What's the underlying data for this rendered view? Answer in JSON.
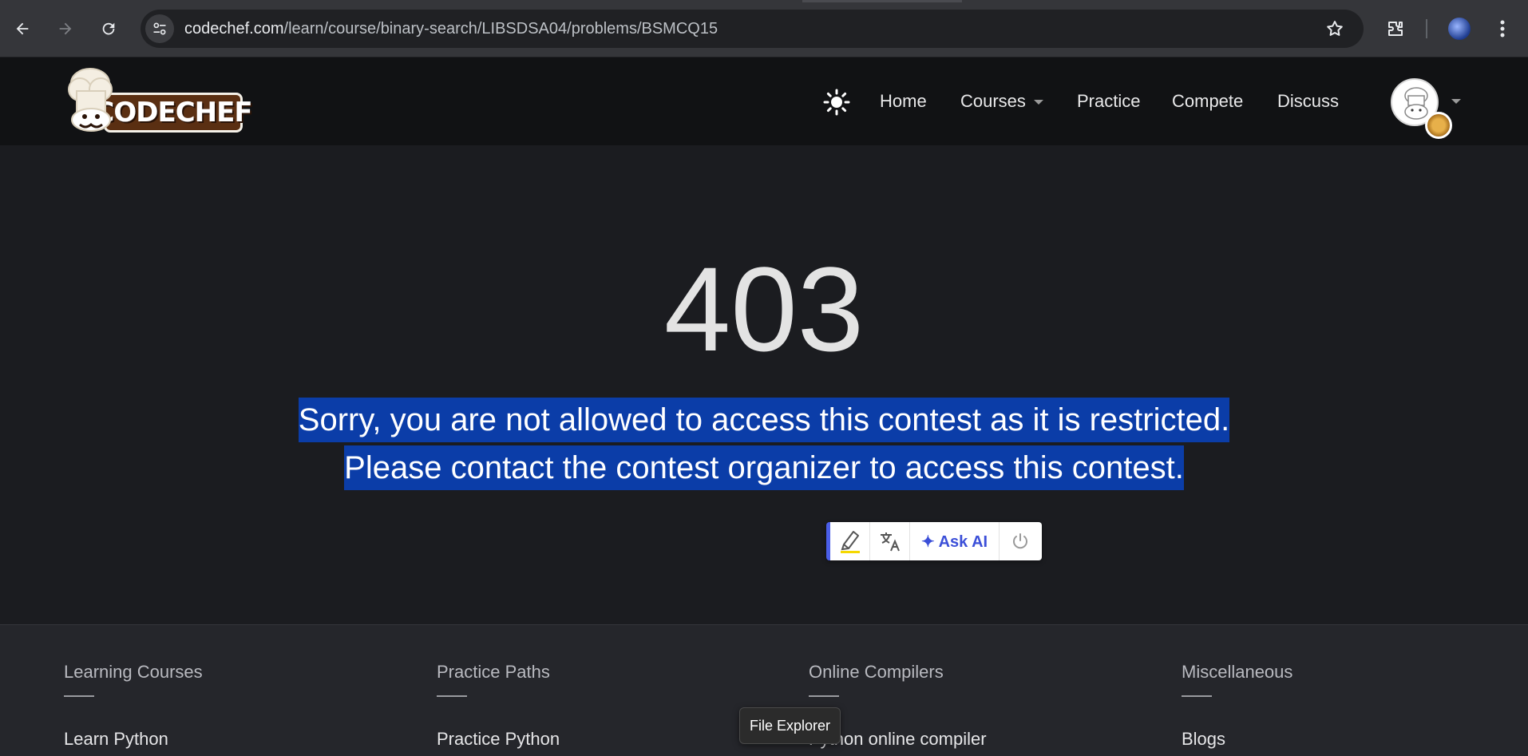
{
  "browser": {
    "url_host": "codechef.com",
    "url_path": "/learn/course/binary-search/LIBSDSA04/problems/BSMCQ15",
    "icons": [
      "back-icon",
      "forward-icon",
      "reload-icon",
      "site-info-icon",
      "star-icon",
      "extensions-icon",
      "profile-icon",
      "menu-icon"
    ]
  },
  "header": {
    "logo_text": "CODECHEF",
    "nav": {
      "home": "Home",
      "courses": "Courses",
      "practice": "Practice",
      "compete": "Compete",
      "discuss": "Discuss"
    }
  },
  "main": {
    "error_code": "403",
    "message": "Sorry, you are not allowed to access this contest as it is restricted. Please contact the contest organizer to access this contest."
  },
  "selection_toolbar": {
    "ask_ai_label": "✦ Ask AI"
  },
  "footer": {
    "columns": [
      {
        "heading": "Learning Courses",
        "link": "Learn Python"
      },
      {
        "heading": "Practice Paths",
        "link": "Practice Python"
      },
      {
        "heading": "Online Compilers",
        "link": "Python online compiler"
      },
      {
        "heading": "Miscellaneous",
        "link": "Blogs"
      }
    ]
  },
  "tooltip": {
    "text": "File Explorer"
  },
  "colors": {
    "selection": "#0b3da8",
    "header_bg": "#111214",
    "page_bg": "#1b1c20",
    "footer_bg": "#25262b",
    "accent": "#3b4fd8"
  }
}
